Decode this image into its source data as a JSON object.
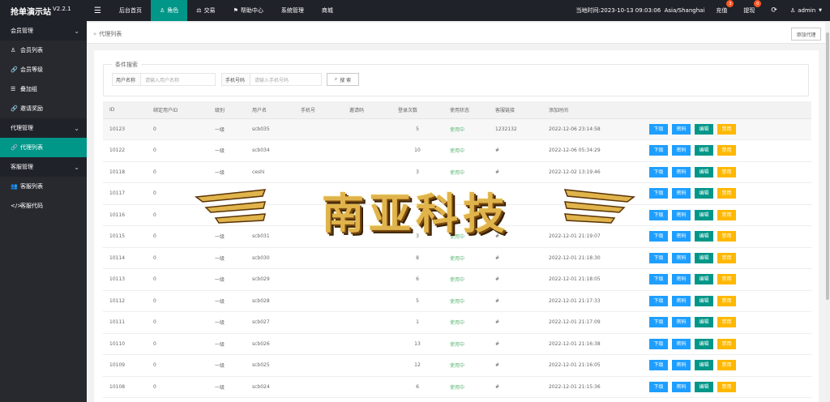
{
  "header": {
    "brand": "抢单演示站",
    "version": "V2.2.1",
    "menu_icon": "☰",
    "nav": [
      {
        "label": "后台首页",
        "icon": ""
      },
      {
        "label": "角色",
        "icon": "♙",
        "active": true
      },
      {
        "label": "交易",
        "icon": "⚖"
      },
      {
        "label": "帮助中心",
        "icon": "⚑"
      },
      {
        "label": "系统管理",
        "icon": ""
      },
      {
        "label": "商城",
        "icon": ""
      }
    ],
    "time_label": "当地时间:2023-10-13 09:03:06",
    "timezone": "Asia/Shanghai",
    "recharge": {
      "label": "充值",
      "count": "3"
    },
    "withdraw": {
      "label": "提现",
      "count": "0"
    },
    "user": "admin"
  },
  "sidebar": {
    "groups": [
      {
        "label": "会员管理",
        "items": [
          {
            "label": "会员列表",
            "icon": "♙"
          },
          {
            "label": "会员等级",
            "icon": "🔗"
          },
          {
            "label": "叠加组",
            "icon": "☰"
          },
          {
            "label": "邀请奖励",
            "icon": "🔗"
          }
        ]
      },
      {
        "label": "代理管理",
        "items": [
          {
            "label": "代理列表",
            "icon": "🔗",
            "active": true
          }
        ]
      },
      {
        "label": "客服管理",
        "items": [
          {
            "label": "客服列表",
            "icon": "👥"
          },
          {
            "label": "客服代码",
            "icon": "</>"
          }
        ]
      }
    ]
  },
  "breadcrumb": {
    "label": "代理列表"
  },
  "toolbar": {
    "add_label": "添加代理"
  },
  "search": {
    "legend": "条件搜索",
    "username_label": "用户名称",
    "username_placeholder": "请输入用户名称",
    "phone_label": "手机号码",
    "phone_placeholder": "请输入手机号码",
    "button": "搜 索"
  },
  "table": {
    "columns": [
      "ID",
      "绑定用户ID",
      "级别",
      "用户名",
      "手机号",
      "邀请码",
      "登录次数",
      "使用状态",
      "客服链接",
      "添加时间",
      ""
    ],
    "actions": [
      "下级",
      "密码",
      "编辑",
      "禁用"
    ],
    "rows": [
      {
        "id": "10123",
        "uid": "0",
        "level": "一级",
        "username": "scb035",
        "phone": "",
        "invite": "",
        "logins": "5",
        "status": "使用中",
        "link": "1232132",
        "time": "2022-12-06 23:14:58"
      },
      {
        "id": "10122",
        "uid": "0",
        "level": "一级",
        "username": "scb034",
        "phone": "",
        "invite": "",
        "logins": "10",
        "status": "使用中",
        "link": "#",
        "time": "2022-12-06 05:34:29"
      },
      {
        "id": "10118",
        "uid": "0",
        "level": "一级",
        "username": "ceshi",
        "phone": "",
        "invite": "",
        "logins": "3",
        "status": "使用中",
        "link": "#",
        "time": "2022-12-02 13:19:46"
      },
      {
        "id": "10117",
        "uid": "0",
        "level": "",
        "username": "",
        "phone": "",
        "invite": "",
        "logins": "",
        "status": "",
        "link": "",
        "time": ""
      },
      {
        "id": "10116",
        "uid": "0",
        "level": "",
        "username": "",
        "phone": "",
        "invite": "",
        "logins": "",
        "status": "",
        "link": "",
        "time": ""
      },
      {
        "id": "10115",
        "uid": "0",
        "level": "一级",
        "username": "scb031",
        "phone": "",
        "invite": "",
        "logins": "3",
        "status": "使用中",
        "link": "#",
        "time": "2022-12-01 21:19:07"
      },
      {
        "id": "10114",
        "uid": "0",
        "level": "一级",
        "username": "scb030",
        "phone": "",
        "invite": "",
        "logins": "8",
        "status": "使用中",
        "link": "#",
        "time": "2022-12-01 21:18:30"
      },
      {
        "id": "10113",
        "uid": "0",
        "level": "一级",
        "username": "scb029",
        "phone": "",
        "invite": "",
        "logins": "6",
        "status": "使用中",
        "link": "#",
        "time": "2022-12-01 21:18:05"
      },
      {
        "id": "10112",
        "uid": "0",
        "level": "一级",
        "username": "scb028",
        "phone": "",
        "invite": "",
        "logins": "5",
        "status": "使用中",
        "link": "#",
        "time": "2022-12-01 21:17:33"
      },
      {
        "id": "10111",
        "uid": "0",
        "level": "一级",
        "username": "scb027",
        "phone": "",
        "invite": "",
        "logins": "1",
        "status": "使用中",
        "link": "#",
        "time": "2022-12-01 21:17:09"
      },
      {
        "id": "10110",
        "uid": "0",
        "level": "一级",
        "username": "scb026",
        "phone": "",
        "invite": "",
        "logins": "13",
        "status": "使用中",
        "link": "#",
        "time": "2022-12-01 21:16:38"
      },
      {
        "id": "10109",
        "uid": "0",
        "level": "一级",
        "username": "scb025",
        "phone": "",
        "invite": "",
        "logins": "12",
        "status": "使用中",
        "link": "#",
        "time": "2022-12-01 21:16:05"
      },
      {
        "id": "10108",
        "uid": "0",
        "level": "一级",
        "username": "scb024",
        "phone": "",
        "invite": "",
        "logins": "6",
        "status": "使用中",
        "link": "#",
        "time": "2022-12-01 21:15:36"
      }
    ]
  },
  "watermark": {
    "text": "南亚科技"
  },
  "colors": {
    "topbar": "#20222a",
    "accent": "#009688",
    "blue": "#1e9fff",
    "orange": "#ffb800",
    "status": "#5fb878"
  }
}
